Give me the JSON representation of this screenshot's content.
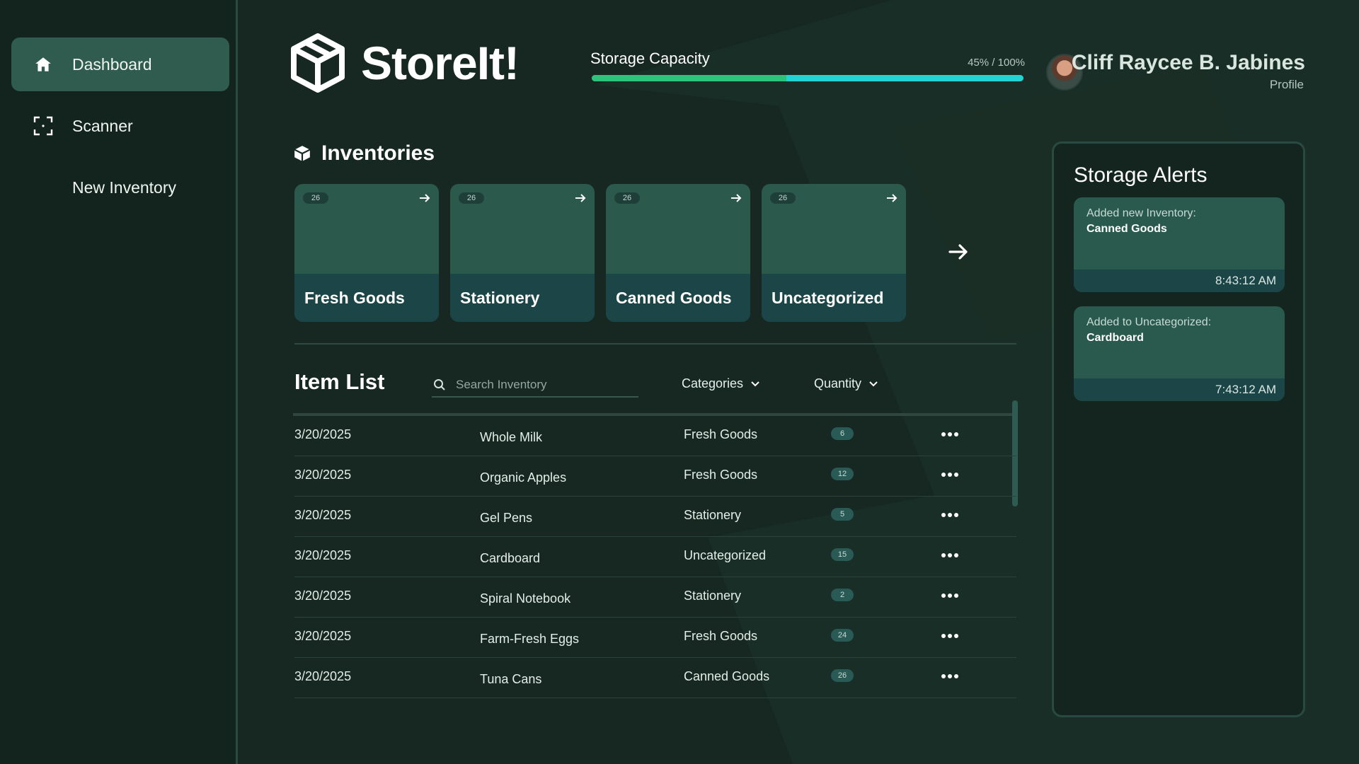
{
  "sidebar": {
    "items": [
      {
        "label": "Dashboard",
        "icon": "home-icon",
        "active": true
      },
      {
        "label": "Scanner",
        "icon": "scan-icon",
        "active": false
      },
      {
        "label": "New Inventory",
        "icon": "",
        "active": false
      }
    ]
  },
  "header": {
    "app_name": "StoreIt!",
    "capacity": {
      "title": "Storage Capacity",
      "value_text": "45% / 100%",
      "percent": 45
    },
    "profile": {
      "name": "Cliff Raycee B. Jabines",
      "link": "Profile"
    }
  },
  "inventories": {
    "title": "Inventories",
    "cards": [
      {
        "name": "Fresh Goods",
        "count": "26"
      },
      {
        "name": "Stationery",
        "count": "26"
      },
      {
        "name": "Canned Goods",
        "count": "26"
      },
      {
        "name": "Uncategorized",
        "count": "26"
      }
    ]
  },
  "item_list": {
    "title": "Item List",
    "search_placeholder": "Search Inventory",
    "filters": {
      "categories": "Categories",
      "quantity": "Quantity"
    },
    "rows": [
      {
        "date": "3/20/2025",
        "name": "Whole Milk",
        "category": "Fresh Goods",
        "qty": "6"
      },
      {
        "date": "3/20/2025",
        "name": "Organic Apples",
        "category": "Fresh Goods",
        "qty": "12"
      },
      {
        "date": "3/20/2025",
        "name": "Gel Pens",
        "category": "Stationery",
        "qty": "5"
      },
      {
        "date": "3/20/2025",
        "name": "Cardboard",
        "category": "Uncategorized",
        "qty": "15"
      },
      {
        "date": "3/20/2025",
        "name": "Spiral Notebook",
        "category": "Stationery",
        "qty": "2"
      },
      {
        "date": "3/20/2025",
        "name": "Farm-Fresh Eggs",
        "category": "Fresh Goods",
        "qty": "24"
      },
      {
        "date": "3/20/2025",
        "name": "Tuna Cans",
        "category": "Canned Goods",
        "qty": "26"
      }
    ]
  },
  "alerts": {
    "title": "Storage Alerts",
    "items": [
      {
        "message": "Added new Inventory:",
        "item": "Canned Goods",
        "time": "8:43:12 AM"
      },
      {
        "message": "Added to Uncategorized:",
        "item": "Cardboard",
        "time": "7:43:12 AM"
      }
    ]
  },
  "colors": {
    "background": "#162821",
    "accent": "#2f5c4e",
    "capacity_green": "#2ec27a",
    "capacity_cyan": "#22d4d4"
  }
}
